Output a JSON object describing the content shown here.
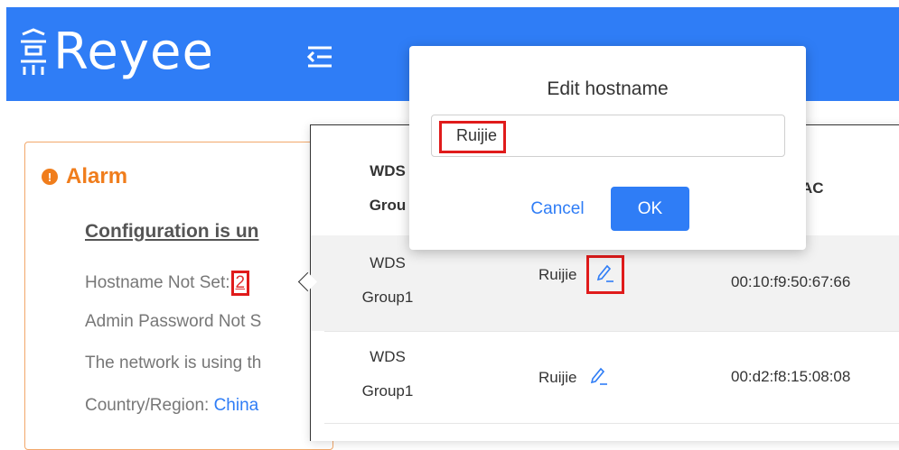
{
  "header": {
    "brand": "Reyee",
    "accent_color": "#2f7df6",
    "menu_icon": "menu-fold-icon"
  },
  "alarm": {
    "title": "Alarm",
    "icon": "exclamation-circle-icon",
    "subtitle": "Configuration is un",
    "hostname_label": "Hostname Not Set:",
    "hostname_count": "2",
    "admin_password": "Admin Password Not S",
    "network_line": "The network is using th",
    "country_label": "Country/Region:",
    "country_value": "China"
  },
  "table": {
    "header": {
      "group_line1": "WDS",
      "group_line2": "Grou",
      "mac": "AC"
    },
    "rows": [
      {
        "group_line1": "WDS",
        "group_line2": "Group1",
        "hostname": "Ruijie",
        "mac": "00:10:f9:50:67:66"
      },
      {
        "group_line1": "WDS",
        "group_line2": "Group1",
        "hostname": "Ruijie",
        "mac": "00:d2:f8:15:08:08"
      }
    ]
  },
  "dialog": {
    "title": "Edit hostname",
    "input_value": "Ruijie",
    "cancel_label": "Cancel",
    "ok_label": "OK"
  }
}
